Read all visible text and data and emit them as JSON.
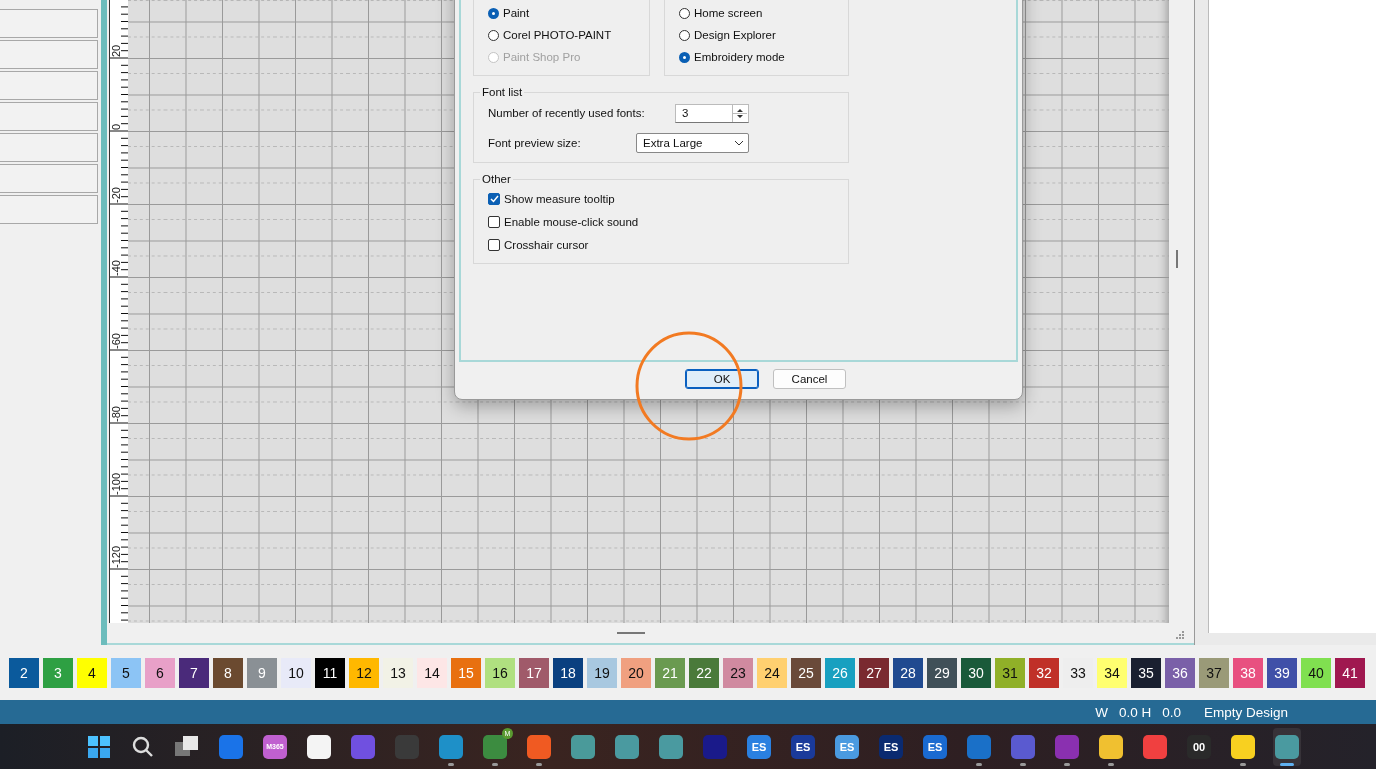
{
  "dialog": {
    "radio_groups": [
      {
        "options": [
          {
            "label": "Paint",
            "selected": true,
            "disabled": false
          },
          {
            "label": "Corel PHOTO-PAINT",
            "selected": false,
            "disabled": false
          },
          {
            "label": "Paint Shop Pro",
            "selected": false,
            "disabled": true
          }
        ]
      },
      {
        "options": [
          {
            "label": "Home screen",
            "selected": false,
            "disabled": false
          },
          {
            "label": "Design Explorer",
            "selected": false,
            "disabled": false
          },
          {
            "label": "Embroidery mode",
            "selected": true,
            "disabled": false
          }
        ]
      }
    ],
    "font_list": {
      "legend": "Font list",
      "recent_label": "Number of recently used fonts:",
      "recent_value": "3",
      "preview_label": "Font preview size:",
      "preview_value": "Extra Large"
    },
    "other": {
      "legend": "Other",
      "options": [
        {
          "label": "Show measure tooltip",
          "checked": true
        },
        {
          "label": "Enable mouse-click sound",
          "checked": false
        },
        {
          "label": "Crosshair cursor",
          "checked": false
        }
      ]
    },
    "buttons": [
      {
        "label": "OK",
        "focused": true
      },
      {
        "label": "Cancel",
        "focused": false
      }
    ]
  },
  "ruler": {
    "labels": [
      "20",
      "0",
      "-20",
      "-40",
      "-60",
      "-80",
      "-100",
      "-120"
    ]
  },
  "palette": [
    {
      "label": "2",
      "color": "#0b5a9c"
    },
    {
      "label": "3",
      "color": "#2ea043"
    },
    {
      "label": "4",
      "color": "#ffff00"
    },
    {
      "label": "5",
      "color": "#8cc4f5"
    },
    {
      "label": "6",
      "color": "#e8a0c8"
    },
    {
      "label": "7",
      "color": "#4a2a7a"
    },
    {
      "label": "8",
      "color": "#6b4a30"
    },
    {
      "label": "9",
      "color": "#8a9095"
    },
    {
      "label": "10",
      "color": "#e8eaf8"
    },
    {
      "label": "11",
      "color": "#000000"
    },
    {
      "label": "12",
      "color": "#ffb800"
    },
    {
      "label": "13",
      "color": "#f2f2e6"
    },
    {
      "label": "14",
      "color": "#fde6e6"
    },
    {
      "label": "15",
      "color": "#e87010"
    },
    {
      "label": "16",
      "color": "#b0e080"
    },
    {
      "label": "17",
      "color": "#a05a6a"
    },
    {
      "label": "18",
      "color": "#0a4080"
    },
    {
      "label": "19",
      "color": "#a8c8e0"
    },
    {
      "label": "20",
      "color": "#f0a080"
    },
    {
      "label": "21",
      "color": "#6a9a50"
    },
    {
      "label": "22",
      "color": "#4a7a3a"
    },
    {
      "label": "23",
      "color": "#d08aa0"
    },
    {
      "label": "24",
      "color": "#ffd070"
    },
    {
      "label": "25",
      "color": "#6a4a3a"
    },
    {
      "label": "26",
      "color": "#18a0c0"
    },
    {
      "label": "27",
      "color": "#7a2a30"
    },
    {
      "label": "28",
      "color": "#204a90"
    },
    {
      "label": "29",
      "color": "#405058"
    },
    {
      "label": "30",
      "color": "#1a5a3a"
    },
    {
      "label": "31",
      "color": "#90b028"
    },
    {
      "label": "32",
      "color": "#c03028"
    },
    {
      "label": "33",
      "color": "#eeeeee"
    },
    {
      "label": "34",
      "color": "#ffff70"
    },
    {
      "label": "35",
      "color": "#1a2030"
    },
    {
      "label": "36",
      "color": "#7a60a8"
    },
    {
      "label": "37",
      "color": "#9a9a78"
    },
    {
      "label": "38",
      "color": "#e85080"
    },
    {
      "label": "39",
      "color": "#4050a8"
    },
    {
      "label": "40",
      "color": "#80e050"
    },
    {
      "label": "41",
      "color": "#a01850"
    }
  ],
  "status_bar": [
    "W",
    "0.0 H",
    "0.0",
    "Empty Design"
  ],
  "taskbar": [
    {
      "kind": "start"
    },
    {
      "kind": "search"
    },
    {
      "kind": "taskview"
    },
    {
      "kind": "app",
      "color": "#1a73e8",
      "running": false,
      "selected": false
    },
    {
      "kind": "app",
      "color": "#c060d0",
      "label": "M365",
      "running": false,
      "selected": false
    },
    {
      "kind": "app",
      "color": "#f4f4f4",
      "running": false,
      "selected": false
    },
    {
      "kind": "app",
      "color": "#7050e0",
      "running": false,
      "selected": false
    },
    {
      "kind": "app",
      "color": "#3a3a3a",
      "running": false,
      "selected": false
    },
    {
      "kind": "app",
      "color": "#1e90c8",
      "running": true,
      "selected": false
    },
    {
      "kind": "app",
      "color": "#3c8c40",
      "badge": "M",
      "running": true,
      "selected": false
    },
    {
      "kind": "app",
      "color": "#f05a22",
      "running": true,
      "selected": false
    },
    {
      "kind": "app",
      "color": "#4a9a9a",
      "running": false,
      "selected": false
    },
    {
      "kind": "app",
      "color": "#4a9aa0",
      "running": false,
      "selected": false
    },
    {
      "kind": "app",
      "color": "#4a9aa0",
      "running": false,
      "selected": false
    },
    {
      "kind": "app",
      "color": "#1a1a8a",
      "running": false,
      "selected": false
    },
    {
      "kind": "app",
      "color": "#2a80e0",
      "label": "ES",
      "running": false,
      "selected": false
    },
    {
      "kind": "app",
      "color": "#1a3a9a",
      "label": "ES",
      "running": false,
      "selected": false
    },
    {
      "kind": "app",
      "color": "#4a9ae0",
      "label": "ES",
      "running": false,
      "selected": false
    },
    {
      "kind": "app",
      "color": "#0a2a70",
      "label": "ES",
      "running": false,
      "selected": false
    },
    {
      "kind": "app",
      "color": "#1a6ad0",
      "label": "ES",
      "running": false,
      "selected": false
    },
    {
      "kind": "app",
      "color": "#1a70c8",
      "running": true,
      "selected": false
    },
    {
      "kind": "app",
      "color": "#5a5ad0",
      "running": true,
      "selected": false
    },
    {
      "kind": "app",
      "color": "#8a30b0",
      "running": true,
      "selected": false
    },
    {
      "kind": "app",
      "color": "#f0c030",
      "running": true,
      "selected": false
    },
    {
      "kind": "app",
      "color": "#f04040",
      "running": false,
      "selected": false
    },
    {
      "kind": "app",
      "color": "#2a2a2a",
      "label": "00",
      "running": false,
      "selected": false
    },
    {
      "kind": "app",
      "color": "#f8d020",
      "running": true,
      "selected": false
    },
    {
      "kind": "app",
      "color": "#4a9aa0",
      "running": true,
      "selected": true
    }
  ]
}
